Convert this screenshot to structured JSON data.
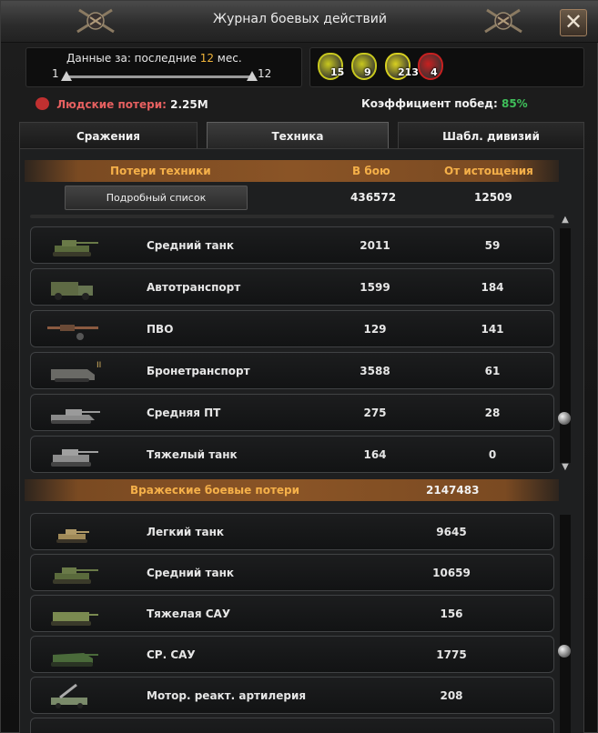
{
  "window": {
    "title": "Журнал боевых действий",
    "close_label": "✕"
  },
  "filter": {
    "label_prefix": "Данные за: последние",
    "months": "12",
    "label_suffix": "мес.",
    "slider_min": "1",
    "slider_max": "12",
    "range_fraction": [
      0,
      1
    ]
  },
  "medals": [
    {
      "value": "15",
      "color": "#c8c81e"
    },
    {
      "value": "9",
      "color": "#c8c81e"
    },
    {
      "value": "213",
      "color": "#d8d020"
    },
    {
      "value": "4",
      "color": "#c82020"
    }
  ],
  "stats": {
    "losses_label": "Людские потери:",
    "losses_value": "2.25M",
    "win_label": "Коэффициент побед:",
    "win_value": "85%"
  },
  "tabs": [
    {
      "label": "Сражения",
      "active": false
    },
    {
      "label": "Техника",
      "active": true
    },
    {
      "label": "Шабл. дивизий",
      "active": false
    }
  ],
  "own_losses": {
    "header": {
      "col1": "Потери техники",
      "col2": "В бою",
      "col3": "От истощения"
    },
    "detail_button": "Подробный список",
    "totals": {
      "combat": "436572",
      "attrition": "12509"
    },
    "rows": [
      {
        "icon": "medium-tank-icon",
        "name": "Средний танк",
        "combat": "2011",
        "attrition": "59"
      },
      {
        "icon": "truck-icon",
        "name": "Автотранспорт",
        "combat": "1599",
        "attrition": "184"
      },
      {
        "icon": "aa-gun-icon",
        "name": "ПВО",
        "combat": "129",
        "attrition": "141"
      },
      {
        "icon": "apc-icon",
        "name": "Бронетранспорт",
        "combat": "3588",
        "attrition": "61"
      },
      {
        "icon": "tank-destroyer-icon",
        "name": "Средняя ПТ",
        "combat": "275",
        "attrition": "28"
      },
      {
        "icon": "heavy-tank-icon",
        "name": "Тяжелый танк",
        "combat": "164",
        "attrition": "0"
      }
    ]
  },
  "enemy_losses": {
    "header": {
      "label": "Вражеские боевые потери",
      "total": "2147483"
    },
    "rows": [
      {
        "icon": "light-tank-icon",
        "name": "Легкий танк",
        "value": "9645"
      },
      {
        "icon": "medium-tank-icon",
        "name": "Средний танк",
        "value": "10659"
      },
      {
        "icon": "heavy-spg-icon",
        "name": "Тяжелая САУ",
        "value": "156"
      },
      {
        "icon": "medium-spg-icon",
        "name": "СР. САУ",
        "value": "1775"
      },
      {
        "icon": "rocket-artillery-icon",
        "name": "Мотор. реакт. артилерия",
        "value": "208"
      }
    ]
  },
  "colors": {
    "accent_orange": "#f5b049",
    "win_green": "#3fbf5a",
    "loss_red": "#e66060"
  }
}
